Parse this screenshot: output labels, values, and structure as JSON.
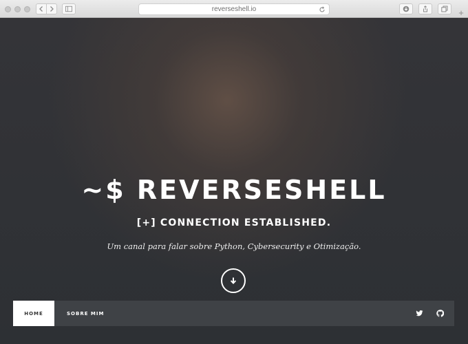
{
  "browser": {
    "url": "reverseshell.io",
    "new_tab_label": "+",
    "icons": {
      "back": "chevron-left-icon",
      "forward": "chevron-right-icon",
      "sidebar": "sidebar-icon",
      "reload": "reload-icon",
      "download": "download-icon",
      "share": "share-icon",
      "tabs": "tabs-icon"
    }
  },
  "hero": {
    "title": "~$ REVERSESHELL",
    "subtitle": "[+] CONNECTION ESTABLISHED.",
    "tagline": "Um canal para falar sobre Python, Cybersecurity e Otimização.",
    "scroll_icon": "arrow-down-icon"
  },
  "nav": {
    "items": [
      {
        "label": "HOME",
        "active": true
      },
      {
        "label": "SOBRE MIM",
        "active": false
      }
    ],
    "social": [
      "twitter-icon",
      "github-icon"
    ]
  },
  "colors": {
    "hero_bg": "#2e3034",
    "hero_glow": "#5e4c44",
    "nav_bg": "#3f4246",
    "nav_active_bg": "#ffffff",
    "text": "#ffffff"
  }
}
